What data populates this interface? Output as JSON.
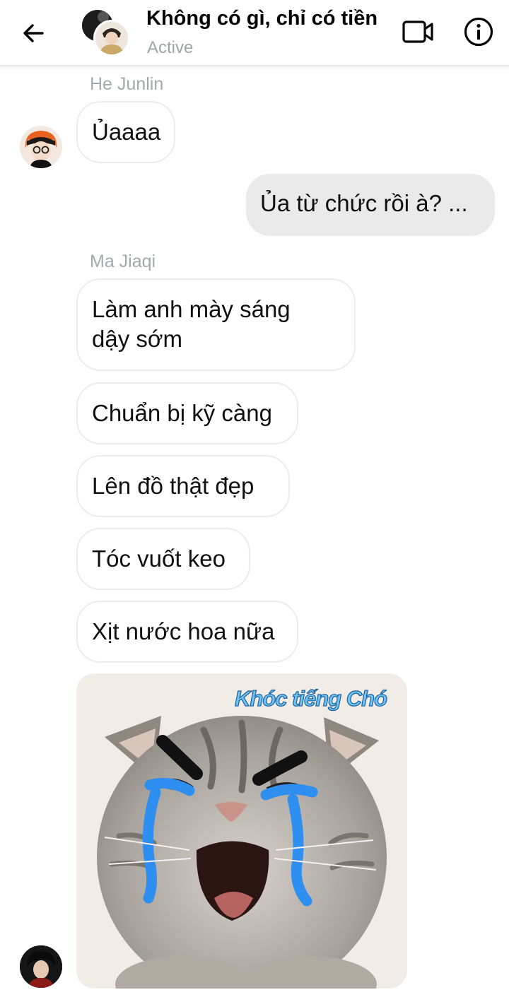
{
  "header": {
    "title": "Không có gì, chỉ có tiền",
    "status": "Active",
    "icons": [
      "back-arrow-icon",
      "video-call-icon",
      "info-icon"
    ]
  },
  "messages": [
    {
      "sender": "He Junlin",
      "direction": "incoming",
      "text": "Ủaaaa"
    },
    {
      "sender": "me",
      "direction": "outgoing",
      "text": "Ủa từ chức rồi à? ..."
    },
    {
      "sender": "Ma Jiaqi",
      "direction": "incoming",
      "text_lines": [
        "Làm anh mày sáng",
        "dậy sớm"
      ]
    },
    {
      "sender": "Ma Jiaqi",
      "direction": "incoming",
      "text": "Chuẩn bị kỹ càng"
    },
    {
      "sender": "Ma Jiaqi",
      "direction": "incoming",
      "text": "Lên đồ thật đẹp"
    },
    {
      "sender": "Ma Jiaqi",
      "direction": "incoming",
      "text": "Tóc vuốt keo"
    },
    {
      "sender": "Ma Jiaqi",
      "direction": "incoming",
      "text": "Xịt nước hoa nữa"
    },
    {
      "sender": "Ma Jiaqi",
      "direction": "incoming",
      "type": "sticker",
      "caption": "Khóc tiếng Chó"
    }
  ],
  "colors": {
    "incoming_bubble": "#ffffff",
    "outgoing_bubble": "#eaeaea",
    "sender_name": "#a5a8ad",
    "tears": "#2f8ff0"
  }
}
